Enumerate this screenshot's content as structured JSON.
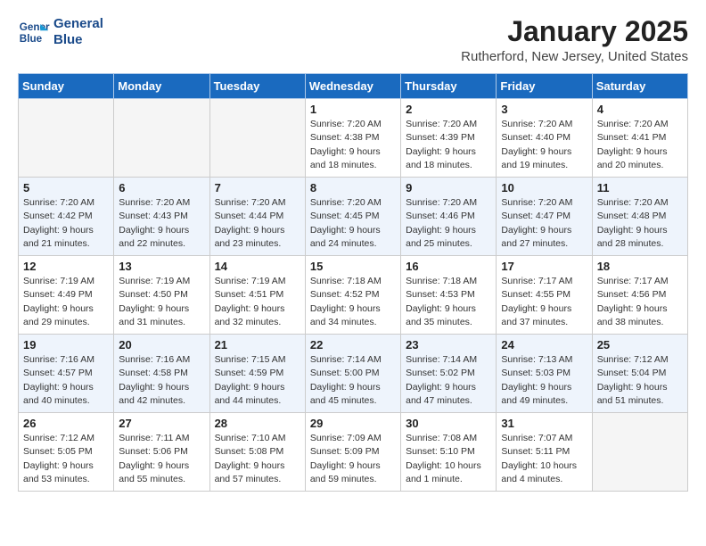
{
  "header": {
    "logo_line1": "General",
    "logo_line2": "Blue",
    "month": "January 2025",
    "location": "Rutherford, New Jersey, United States"
  },
  "weekdays": [
    "Sunday",
    "Monday",
    "Tuesday",
    "Wednesday",
    "Thursday",
    "Friday",
    "Saturday"
  ],
  "weeks": [
    [
      {
        "day": "",
        "info": ""
      },
      {
        "day": "",
        "info": ""
      },
      {
        "day": "",
        "info": ""
      },
      {
        "day": "1",
        "info": "Sunrise: 7:20 AM\nSunset: 4:38 PM\nDaylight: 9 hours\nand 18 minutes."
      },
      {
        "day": "2",
        "info": "Sunrise: 7:20 AM\nSunset: 4:39 PM\nDaylight: 9 hours\nand 18 minutes."
      },
      {
        "day": "3",
        "info": "Sunrise: 7:20 AM\nSunset: 4:40 PM\nDaylight: 9 hours\nand 19 minutes."
      },
      {
        "day": "4",
        "info": "Sunrise: 7:20 AM\nSunset: 4:41 PM\nDaylight: 9 hours\nand 20 minutes."
      }
    ],
    [
      {
        "day": "5",
        "info": "Sunrise: 7:20 AM\nSunset: 4:42 PM\nDaylight: 9 hours\nand 21 minutes."
      },
      {
        "day": "6",
        "info": "Sunrise: 7:20 AM\nSunset: 4:43 PM\nDaylight: 9 hours\nand 22 minutes."
      },
      {
        "day": "7",
        "info": "Sunrise: 7:20 AM\nSunset: 4:44 PM\nDaylight: 9 hours\nand 23 minutes."
      },
      {
        "day": "8",
        "info": "Sunrise: 7:20 AM\nSunset: 4:45 PM\nDaylight: 9 hours\nand 24 minutes."
      },
      {
        "day": "9",
        "info": "Sunrise: 7:20 AM\nSunset: 4:46 PM\nDaylight: 9 hours\nand 25 minutes."
      },
      {
        "day": "10",
        "info": "Sunrise: 7:20 AM\nSunset: 4:47 PM\nDaylight: 9 hours\nand 27 minutes."
      },
      {
        "day": "11",
        "info": "Sunrise: 7:20 AM\nSunset: 4:48 PM\nDaylight: 9 hours\nand 28 minutes."
      }
    ],
    [
      {
        "day": "12",
        "info": "Sunrise: 7:19 AM\nSunset: 4:49 PM\nDaylight: 9 hours\nand 29 minutes."
      },
      {
        "day": "13",
        "info": "Sunrise: 7:19 AM\nSunset: 4:50 PM\nDaylight: 9 hours\nand 31 minutes."
      },
      {
        "day": "14",
        "info": "Sunrise: 7:19 AM\nSunset: 4:51 PM\nDaylight: 9 hours\nand 32 minutes."
      },
      {
        "day": "15",
        "info": "Sunrise: 7:18 AM\nSunset: 4:52 PM\nDaylight: 9 hours\nand 34 minutes."
      },
      {
        "day": "16",
        "info": "Sunrise: 7:18 AM\nSunset: 4:53 PM\nDaylight: 9 hours\nand 35 minutes."
      },
      {
        "day": "17",
        "info": "Sunrise: 7:17 AM\nSunset: 4:55 PM\nDaylight: 9 hours\nand 37 minutes."
      },
      {
        "day": "18",
        "info": "Sunrise: 7:17 AM\nSunset: 4:56 PM\nDaylight: 9 hours\nand 38 minutes."
      }
    ],
    [
      {
        "day": "19",
        "info": "Sunrise: 7:16 AM\nSunset: 4:57 PM\nDaylight: 9 hours\nand 40 minutes."
      },
      {
        "day": "20",
        "info": "Sunrise: 7:16 AM\nSunset: 4:58 PM\nDaylight: 9 hours\nand 42 minutes."
      },
      {
        "day": "21",
        "info": "Sunrise: 7:15 AM\nSunset: 4:59 PM\nDaylight: 9 hours\nand 44 minutes."
      },
      {
        "day": "22",
        "info": "Sunrise: 7:14 AM\nSunset: 5:00 PM\nDaylight: 9 hours\nand 45 minutes."
      },
      {
        "day": "23",
        "info": "Sunrise: 7:14 AM\nSunset: 5:02 PM\nDaylight: 9 hours\nand 47 minutes."
      },
      {
        "day": "24",
        "info": "Sunrise: 7:13 AM\nSunset: 5:03 PM\nDaylight: 9 hours\nand 49 minutes."
      },
      {
        "day": "25",
        "info": "Sunrise: 7:12 AM\nSunset: 5:04 PM\nDaylight: 9 hours\nand 51 minutes."
      }
    ],
    [
      {
        "day": "26",
        "info": "Sunrise: 7:12 AM\nSunset: 5:05 PM\nDaylight: 9 hours\nand 53 minutes."
      },
      {
        "day": "27",
        "info": "Sunrise: 7:11 AM\nSunset: 5:06 PM\nDaylight: 9 hours\nand 55 minutes."
      },
      {
        "day": "28",
        "info": "Sunrise: 7:10 AM\nSunset: 5:08 PM\nDaylight: 9 hours\nand 57 minutes."
      },
      {
        "day": "29",
        "info": "Sunrise: 7:09 AM\nSunset: 5:09 PM\nDaylight: 9 hours\nand 59 minutes."
      },
      {
        "day": "30",
        "info": "Sunrise: 7:08 AM\nSunset: 5:10 PM\nDaylight: 10 hours\nand 1 minute."
      },
      {
        "day": "31",
        "info": "Sunrise: 7:07 AM\nSunset: 5:11 PM\nDaylight: 10 hours\nand 4 minutes."
      },
      {
        "day": "",
        "info": ""
      }
    ]
  ]
}
